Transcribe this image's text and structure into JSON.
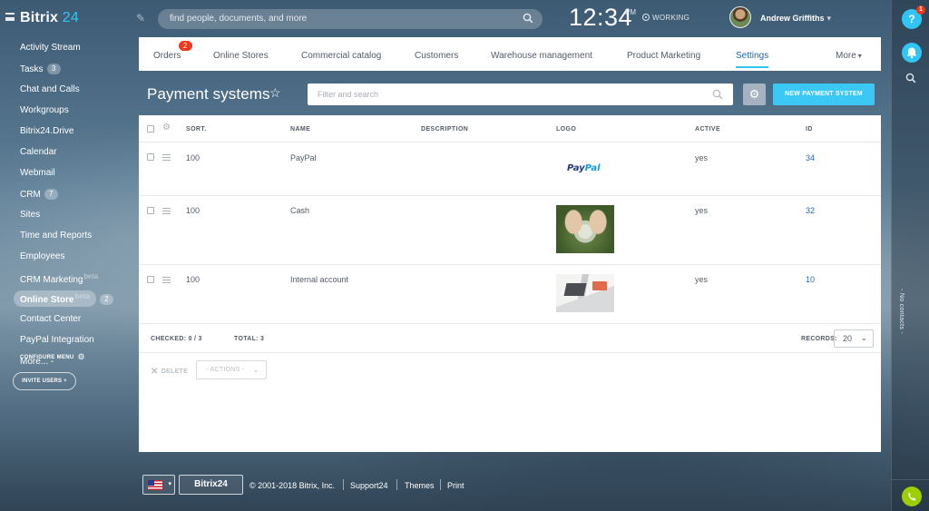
{
  "app": {
    "logo_text": "Bitrix",
    "logo_num": "24"
  },
  "topbar": {
    "search_placeholder": "find people, documents, and more",
    "time": "12:34",
    "ampm": "PM",
    "status": "WORKING",
    "user_name": "Andrew Griffiths"
  },
  "leftmenu": {
    "items": [
      {
        "label": "Activity Stream"
      },
      {
        "label": "Tasks",
        "counter": "3"
      },
      {
        "label": "Chat and Calls"
      },
      {
        "label": "Workgroups"
      },
      {
        "label": "Bitrix24.Drive"
      },
      {
        "label": "Calendar"
      },
      {
        "label": "Webmail"
      },
      {
        "label": "CRM",
        "counter": "7"
      },
      {
        "label": "Sites"
      },
      {
        "label": "Time and Reports"
      },
      {
        "label": "Employees"
      },
      {
        "label": "CRM Marketing",
        "beta": "beta"
      },
      {
        "label": "Online Store",
        "beta": "beta",
        "counter": "2"
      },
      {
        "label": "Contact Center"
      },
      {
        "label": "PayPal Integration"
      },
      {
        "label": "More... -"
      }
    ],
    "configure": "CONFIGURE MENU",
    "invite": "INVITE USERS +"
  },
  "tabs": {
    "items": [
      {
        "label": "Orders",
        "badge": "2"
      },
      {
        "label": "Online Stores"
      },
      {
        "label": "Commercial catalog"
      },
      {
        "label": "Customers"
      },
      {
        "label": "Warehouse management"
      },
      {
        "label": "Product Marketing"
      },
      {
        "label": "Settings"
      },
      {
        "label": "More"
      }
    ],
    "selected": "Settings"
  },
  "page": {
    "title": "Payment systems",
    "filter_placeholder": "Filter and search",
    "new_button": "NEW PAYMENT SYSTEM"
  },
  "grid": {
    "columns": {
      "sort": "SORT.",
      "name": "NAME",
      "description": "DESCRIPTION",
      "logo": "LOGO",
      "active": "ACTIVE",
      "id": "ID"
    },
    "rows": [
      {
        "sort": "100",
        "name": "PayPal",
        "description": "",
        "logo": "PayPal",
        "active": "yes",
        "id": "34"
      },
      {
        "sort": "100",
        "name": "Cash",
        "description": "",
        "logo": "cash-photo",
        "active": "yes",
        "id": "32"
      },
      {
        "sort": "100",
        "name": "Internal account",
        "description": "",
        "logo": "laptop-photo",
        "active": "yes",
        "id": "10"
      }
    ],
    "checked_label": "CHECKED: 0 / 3",
    "total_label": "TOTAL: 3",
    "records_label": "RECORDS:",
    "records_value": "20",
    "delete_label": "DELETE",
    "actions_label": "- ACTIONS -"
  },
  "footer": {
    "brand": "Bitrix24",
    "copyright": "© 2001-2018 Bitrix, Inc.",
    "support": "Support24",
    "themes": "Themes",
    "print": "Print"
  },
  "rightbar": {
    "help_badge": "1",
    "no_contacts": "- No contacts -"
  },
  "colors": {
    "accent": "#2fc6f6",
    "link": "#2067b0",
    "badge": "#f0371b",
    "phone": "#9dcf00"
  }
}
